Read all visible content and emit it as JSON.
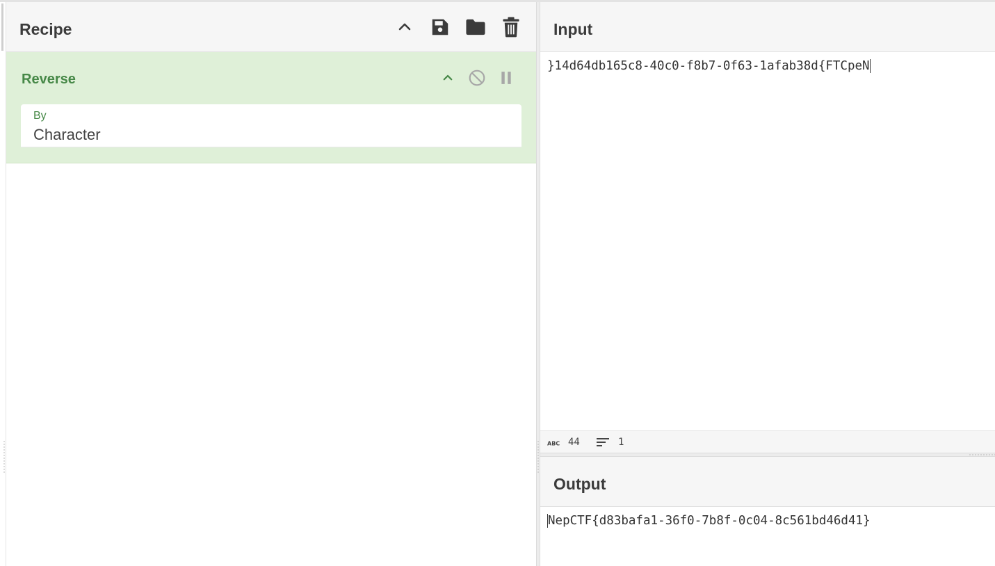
{
  "recipe": {
    "title": "Recipe",
    "icons": [
      "chevron-up-icon",
      "save-icon",
      "folder-icon",
      "trash-icon"
    ]
  },
  "operation": {
    "name": "Reverse",
    "arg_label": "By",
    "arg_value": "Character",
    "icons": [
      "chevron-up-icon",
      "disable-icon",
      "pause-icon"
    ]
  },
  "input": {
    "title": "Input",
    "text": "}14d64db165c8-40c0-f8b7-0f63-1afab38d{FTCpeN",
    "status": {
      "length_icon": "abc-icon",
      "length": "44",
      "lines_icon": "lines-icon",
      "lines": "1"
    }
  },
  "output": {
    "title": "Output",
    "text": "NepCTF{d83bafa1-36f0-7b8f-0c04-8c561bd46d41}"
  },
  "colors": {
    "header_bg": "#f6f6f6",
    "operation_bg": "#dff0d8",
    "operation_text": "#468847",
    "icon": "#3b3b3b"
  }
}
